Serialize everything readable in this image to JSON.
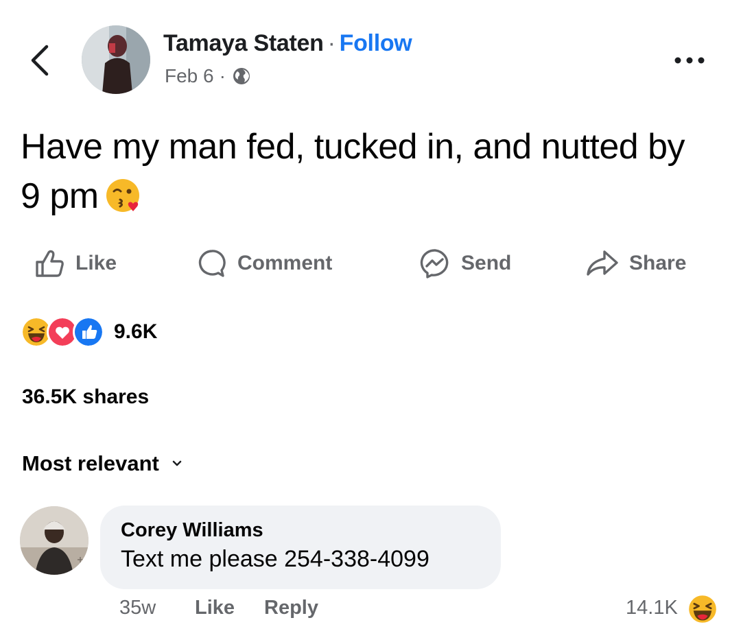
{
  "post": {
    "author": "Tamaya Staten",
    "separator": "·",
    "follow_label": "Follow",
    "date": "Feb 6",
    "privacy_icon": "globe-icon",
    "text": "Have my man fed, tucked in, and nutted by 9 pm",
    "emoji": "kissing-heart-emoji"
  },
  "actions": {
    "like": "Like",
    "comment": "Comment",
    "send": "Send",
    "share": "Share"
  },
  "stats": {
    "reaction_icons": [
      "haha-icon",
      "love-icon",
      "like-icon"
    ],
    "reaction_count": "9.6K",
    "shares": "36.5K shares"
  },
  "comments_sort": "Most relevant",
  "comment": {
    "author": "Corey Williams",
    "text": "Text me please 254-338-4099",
    "time": "35w",
    "like_label": "Like",
    "reply_label": "Reply",
    "reaction_count": "14.1K",
    "reaction_icon": "haha-icon"
  },
  "colors": {
    "accent": "#1877f2",
    "secondary_text": "#65676b",
    "bubble": "#f0f2f5",
    "love": "#f33e58",
    "haha": "#f7b928"
  }
}
